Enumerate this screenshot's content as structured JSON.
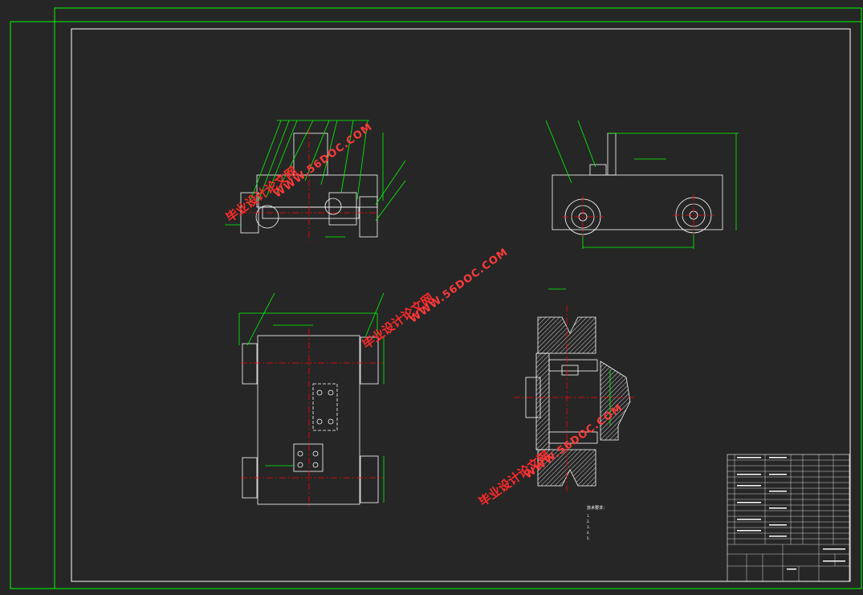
{
  "drawing": {
    "technical_requirements": {
      "title": "技术要求：",
      "lines": [
        "1.",
        "2.",
        "3.",
        "4.",
        "5."
      ]
    },
    "title_block_caption": ""
  },
  "watermark": {
    "cn": "毕业设计论文网",
    "url": "WWW.56DOC.COM"
  },
  "colors": {
    "background": "#262626",
    "linework": "#ffffff",
    "frame": "#00ff00",
    "centerline": "#ff0000",
    "hatch": "#ffffff",
    "watermark": "#ff2a2a"
  }
}
